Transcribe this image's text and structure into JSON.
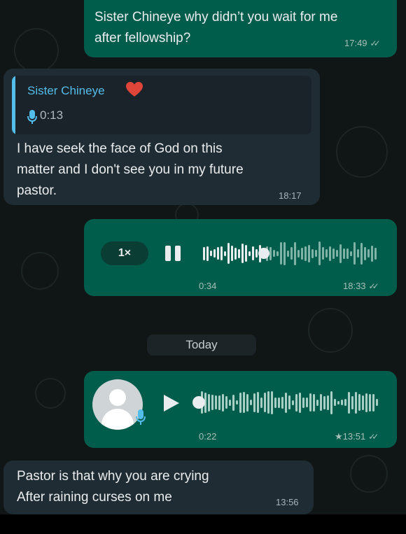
{
  "messages": {
    "m1": {
      "text_line1": "Sister Chineye why didn’t you wait for me",
      "text_line2": "after fellowship?",
      "time": "17:49"
    },
    "m2": {
      "quote_sender": "Sister Chineye",
      "quote_duration": "0:13",
      "text_line1": "I have seek the face of God on this",
      "text_line2": "matter and I don't see you in my future",
      "text_line3": "pastor.",
      "time": "18:17"
    },
    "m3": {
      "speed": "1×",
      "duration": "0:34",
      "time": "18:33",
      "progress": 0.35
    },
    "date_divider": "Today",
    "m4": {
      "duration": "0:22",
      "time": "★13:51",
      "progress": 0
    },
    "m5": {
      "text_line1": "Pastor is that why you are crying",
      "text_line2": "After raining curses on me",
      "time": "13:56"
    }
  },
  "icons": {
    "read_receipt": "double-check-icon",
    "voice": "microphone-icon",
    "heart": "heart-icon",
    "play": "play-icon",
    "pause": "pause-icon",
    "avatar": "default-avatar-icon"
  },
  "colors": {
    "outgoing_bubble": "#005c4b",
    "incoming_bubble": "#202c33",
    "quote_accent": "#53bdeb",
    "background": "#101515"
  }
}
